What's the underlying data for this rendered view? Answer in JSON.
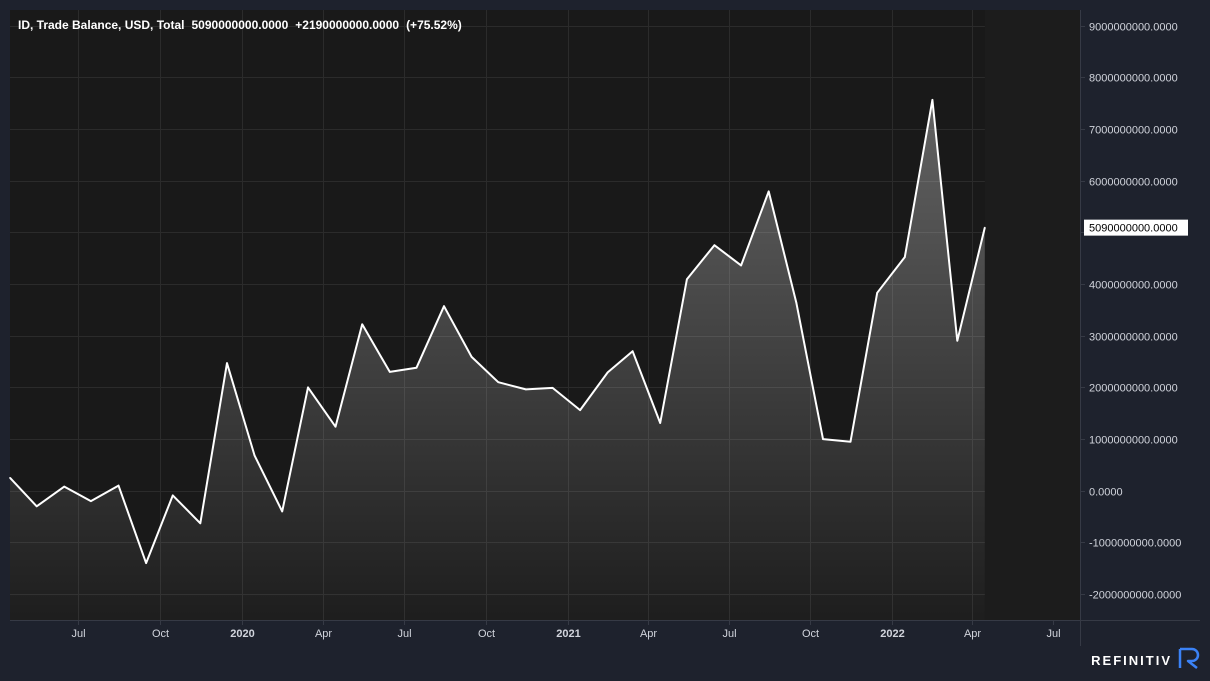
{
  "chart_data": {
    "type": "area",
    "title": "ID, Trade Balance, USD, Total",
    "legend_value": "5090000000.0000",
    "legend_change": "+2190000000.0000",
    "legend_change_pct": "(+75.52%)",
    "last_value_label": "5090000000.0000",
    "xlabel": "",
    "ylabel": "",
    "ylim": [
      -2500000000,
      9300000000
    ],
    "x_range": [
      "2019-04-15",
      "2022-07-31"
    ],
    "grid": true,
    "y_ticks": [
      {
        "value": 9000000000,
        "label": "9000000000.0000"
      },
      {
        "value": 8000000000,
        "label": "8000000000.0000"
      },
      {
        "value": 7000000000,
        "label": "7000000000.0000"
      },
      {
        "value": 6000000000,
        "label": "6000000000.0000"
      },
      {
        "value": 5000000000,
        "label": ""
      },
      {
        "value": 4000000000,
        "label": "4000000000.0000"
      },
      {
        "value": 3000000000,
        "label": "3000000000.0000"
      },
      {
        "value": 2000000000,
        "label": "2000000000.0000"
      },
      {
        "value": 1000000000,
        "label": "1000000000.0000"
      },
      {
        "value": 0,
        "label": "0.0000"
      },
      {
        "value": -1000000000,
        "label": "-1000000000.0000"
      },
      {
        "value": -2000000000,
        "label": "-2000000000.0000"
      }
    ],
    "x_ticks": [
      {
        "date": "2019-07-01",
        "label": "Jul",
        "bold": false
      },
      {
        "date": "2019-10-01",
        "label": "Oct",
        "bold": false
      },
      {
        "date": "2020-01-01",
        "label": "2020",
        "bold": true
      },
      {
        "date": "2020-04-01",
        "label": "Apr",
        "bold": false
      },
      {
        "date": "2020-07-01",
        "label": "Jul",
        "bold": false
      },
      {
        "date": "2020-10-01",
        "label": "Oct",
        "bold": false
      },
      {
        "date": "2021-01-01",
        "label": "2021",
        "bold": true
      },
      {
        "date": "2021-04-01",
        "label": "Apr",
        "bold": false
      },
      {
        "date": "2021-07-01",
        "label": "Jul",
        "bold": false
      },
      {
        "date": "2021-10-01",
        "label": "Oct",
        "bold": false
      },
      {
        "date": "2022-01-01",
        "label": "2022",
        "bold": true
      },
      {
        "date": "2022-04-01",
        "label": "Apr",
        "bold": false
      },
      {
        "date": "2022-07-01",
        "label": "Jul",
        "bold": false
      }
    ],
    "series": [
      {
        "points": [
          {
            "x": "2019-04-15",
            "y": 250000000
          },
          {
            "x": "2019-05-15",
            "y": -300000000
          },
          {
            "x": "2019-06-15",
            "y": 80000000
          },
          {
            "x": "2019-07-15",
            "y": -200000000
          },
          {
            "x": "2019-08-15",
            "y": 100000000
          },
          {
            "x": "2019-09-15",
            "y": -1400000000
          },
          {
            "x": "2019-10-15",
            "y": -90000000
          },
          {
            "x": "2019-11-15",
            "y": -630000000
          },
          {
            "x": "2019-12-15",
            "y": 2470000000
          },
          {
            "x": "2020-01-15",
            "y": 680000000
          },
          {
            "x": "2020-02-15",
            "y": -400000000
          },
          {
            "x": "2020-03-15",
            "y": 2000000000
          },
          {
            "x": "2020-04-15",
            "y": 1240000000
          },
          {
            "x": "2020-05-15",
            "y": 3220000000
          },
          {
            "x": "2020-06-15",
            "y": 2300000000
          },
          {
            "x": "2020-07-15",
            "y": 2380000000
          },
          {
            "x": "2020-08-15",
            "y": 3570000000
          },
          {
            "x": "2020-09-15",
            "y": 2590000000
          },
          {
            "x": "2020-10-15",
            "y": 2100000000
          },
          {
            "x": "2020-11-15",
            "y": 1960000000
          },
          {
            "x": "2020-12-15",
            "y": 1990000000
          },
          {
            "x": "2021-01-15",
            "y": 1560000000
          },
          {
            "x": "2021-02-15",
            "y": 2290000000
          },
          {
            "x": "2021-03-15",
            "y": 2700000000
          },
          {
            "x": "2021-04-15",
            "y": 1310000000
          },
          {
            "x": "2021-05-15",
            "y": 4090000000
          },
          {
            "x": "2021-06-15",
            "y": 4750000000
          },
          {
            "x": "2021-07-15",
            "y": 4360000000
          },
          {
            "x": "2021-08-15",
            "y": 5790000000
          },
          {
            "x": "2021-09-15",
            "y": 3640000000
          },
          {
            "x": "2021-10-15",
            "y": 1000000000
          },
          {
            "x": "2021-11-15",
            "y": 950000000
          },
          {
            "x": "2021-12-15",
            "y": 3830000000
          },
          {
            "x": "2022-01-15",
            "y": 4520000000
          },
          {
            "x": "2022-02-15",
            "y": 7560000000
          },
          {
            "x": "2022-03-15",
            "y": 2900000000
          },
          {
            "x": "2022-04-15",
            "y": 5090000000
          }
        ]
      }
    ]
  },
  "colors": {
    "background": "#1e222d",
    "plot_background": "#191919",
    "grid": "#2b2b2b",
    "line": "#ffffff",
    "axis_text": "#d1d4dc",
    "axis_line": "#363a45",
    "label_bg": "#ffffff",
    "label_text": "#000000",
    "brand_accent": "#3b82f6"
  },
  "brand": {
    "name": "REFINITIV",
    "icon": "refinitiv-logo-icon"
  }
}
